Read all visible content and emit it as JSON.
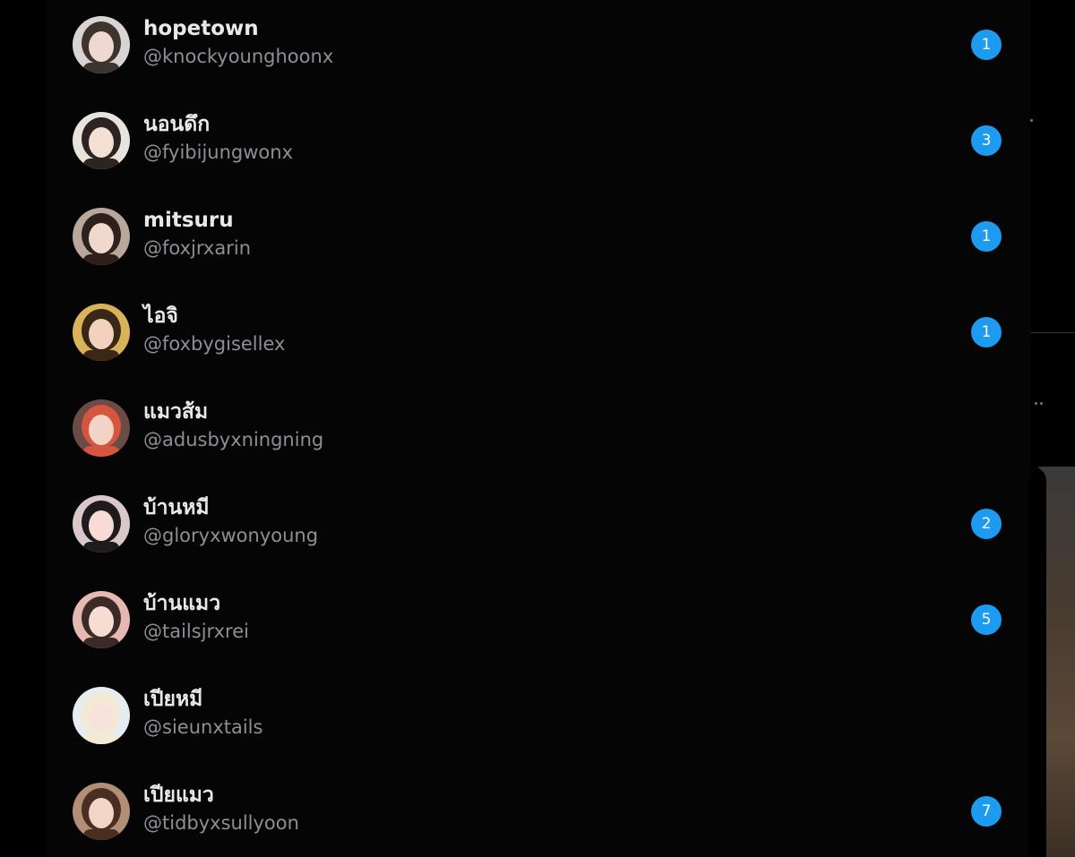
{
  "conversations": [
    {
      "name": "hopetown",
      "handle": "@knockyounghoonx",
      "unread": "1",
      "avatar_bg": "#d9d4d2",
      "avatar_fg": "#3b3431",
      "avatar_skin": "#efd8cf"
    },
    {
      "name": "นอนดึก",
      "handle": "@fyibijungwonx",
      "unread": "3",
      "avatar_bg": "#e8e3dc",
      "avatar_fg": "#2b2420",
      "avatar_skin": "#f3dfd3"
    },
    {
      "name": "mitsuru",
      "handle": "@foxjrxarin",
      "unread": "1",
      "avatar_bg": "#b9a79b",
      "avatar_fg": "#2e211b",
      "avatar_skin": "#f1d8cc"
    },
    {
      "name": "ไอจิ",
      "handle": "@foxbygisellex",
      "unread": "1",
      "avatar_bg": "#d8b35a",
      "avatar_fg": "#3a2716",
      "avatar_skin": "#f0d2bf"
    },
    {
      "name": "แมวส้ม",
      "handle": "@adusbyxningning",
      "unread": "",
      "avatar_bg": "#6b4b45",
      "avatar_fg": "#d6553f",
      "avatar_skin": "#f2d3c5"
    },
    {
      "name": "บ้านหมี",
      "handle": "@gloryxwonyoung",
      "unread": "2",
      "avatar_bg": "#d9c7c9",
      "avatar_fg": "#1f1a1d",
      "avatar_skin": "#f6dcd4"
    },
    {
      "name": "บ้านแมว",
      "handle": "@tailsjrxrei",
      "unread": "5",
      "avatar_bg": "#e5b9b2",
      "avatar_fg": "#3b2a28",
      "avatar_skin": "#f7dcd2"
    },
    {
      "name": "เปียหมี",
      "handle": "@sieunxtails",
      "unread": "",
      "avatar_bg": "#e7ecf2",
      "avatar_fg": "#f3ead6",
      "avatar_skin": "#f7e3dc"
    },
    {
      "name": "เปียแมว",
      "handle": "@tidbyxsullyoon",
      "unread": "7",
      "avatar_bg": "#b38e76",
      "avatar_fg": "#4a2e22",
      "avatar_skin": "#f1d5c6"
    }
  ]
}
